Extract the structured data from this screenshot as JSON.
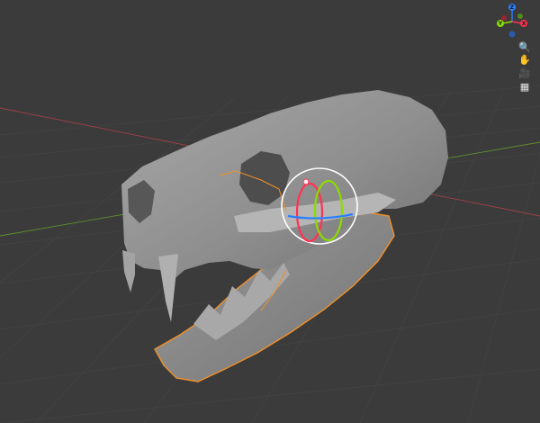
{
  "viewport": {
    "background": "#3b3b3b",
    "grid_color": "#454545",
    "x_axis_color": "#a0404a",
    "y_axis_color": "#5f8f2f"
  },
  "navigation_gizmo": {
    "axes": [
      {
        "name": "z-axis",
        "label": "Z",
        "color": "#2a7fff"
      },
      {
        "name": "x-axis",
        "label": "X",
        "color": "#ff3352"
      },
      {
        "name": "y-axis",
        "label": "Y",
        "color": "#8bdc00"
      },
      {
        "name": "neg-x-axis",
        "label": "",
        "color": "#9c2334"
      },
      {
        "name": "neg-y-axis",
        "label": "",
        "color": "#4f8a1a"
      },
      {
        "name": "neg-z-axis",
        "label": "",
        "color": "#2a5aa8"
      }
    ]
  },
  "view_buttons": [
    {
      "name": "zoom-icon",
      "glyph": "🔍"
    },
    {
      "name": "pan-hand-icon",
      "glyph": "✋"
    },
    {
      "name": "camera-icon",
      "glyph": "🎥"
    },
    {
      "name": "ortho-grid-icon",
      "glyph": "▦"
    }
  ],
  "selection": {
    "outline_color": "#f0902a",
    "object": "skull-mesh"
  },
  "rotate_gizmo": {
    "outer_ring_color": "#ffffff",
    "x_ring_color": "#ff3352",
    "y_ring_color": "#8bdc00",
    "z_ring_color": "#2a7fff"
  }
}
